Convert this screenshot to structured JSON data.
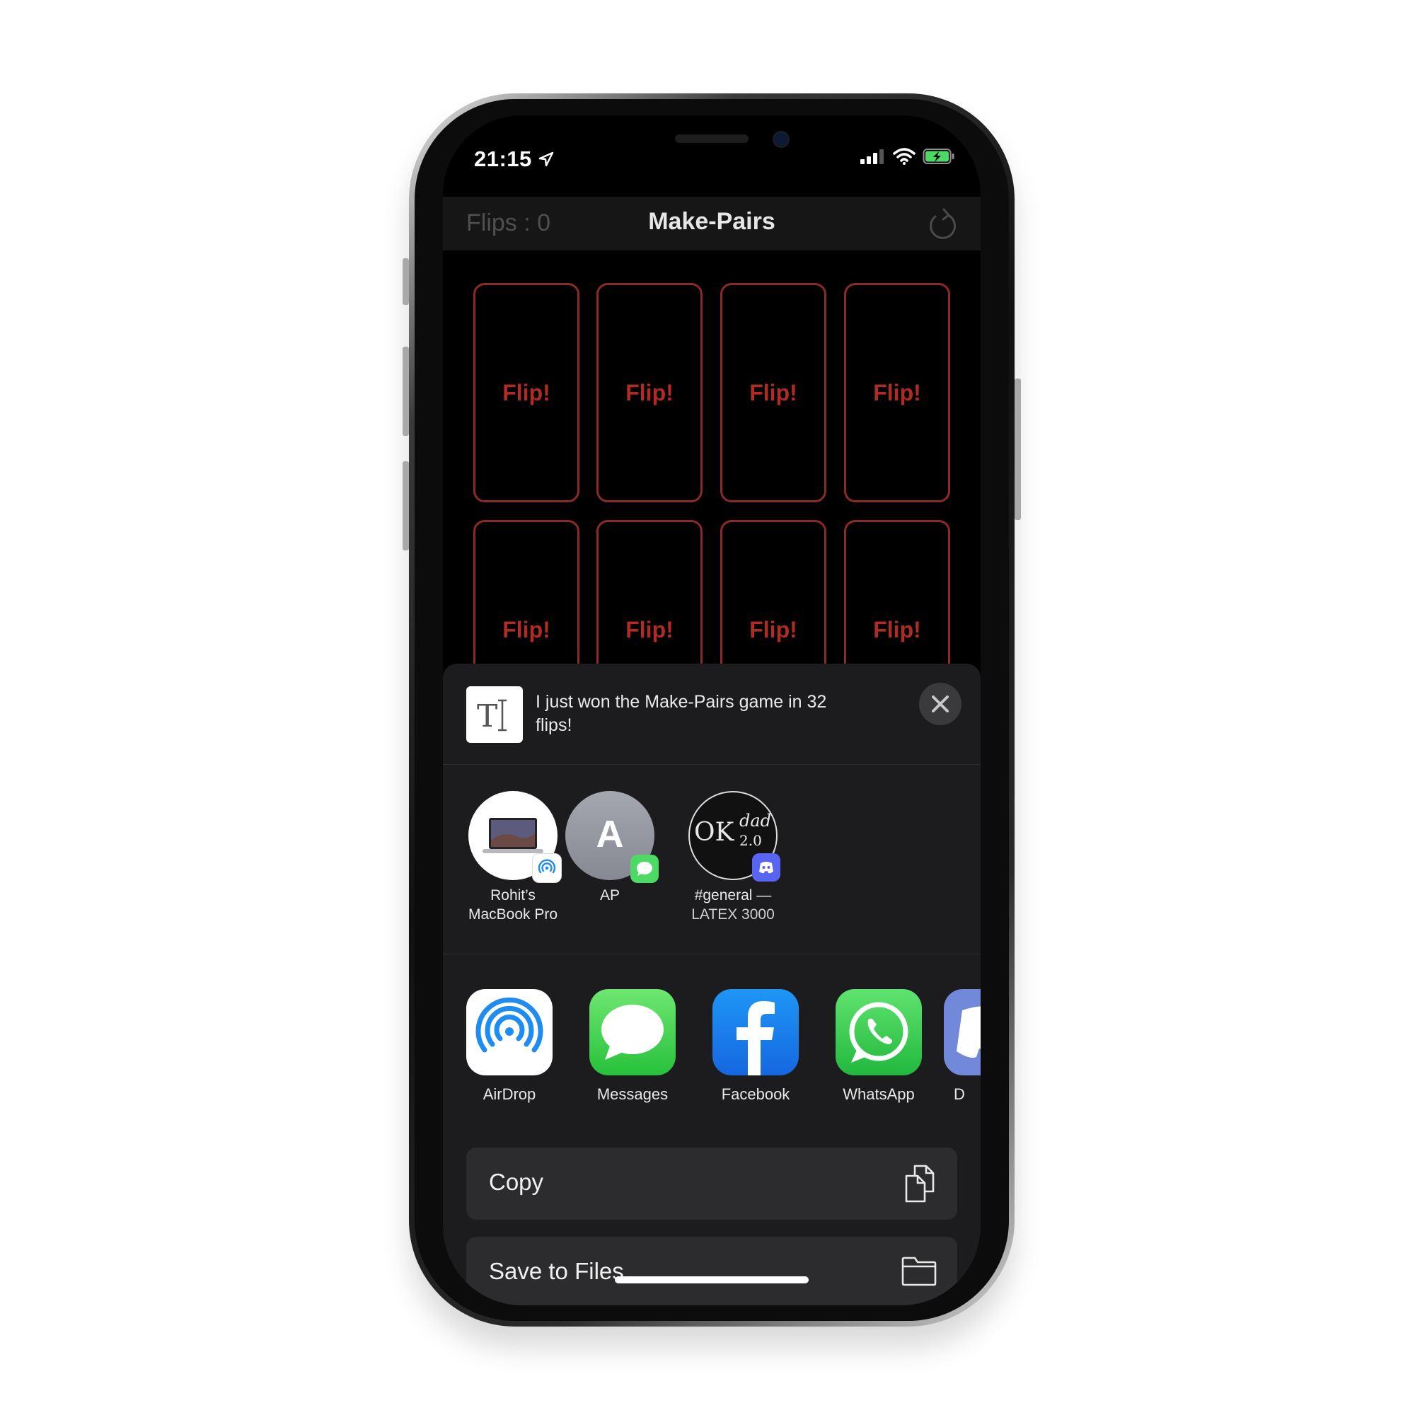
{
  "status": {
    "time": "21:15"
  },
  "navbar": {
    "flips_label": "Flips : 0",
    "title": "Make-Pairs"
  },
  "cards": [
    "Flip!",
    "Flip!",
    "Flip!",
    "Flip!",
    "Flip!",
    "Flip!",
    "Flip!",
    "Flip!"
  ],
  "share": {
    "preview_text": "I just won the Make-Pairs game in 32 flips!",
    "contacts": [
      {
        "line1": "Rohit’s",
        "line2": "MacBook Pro"
      },
      {
        "initial": "A",
        "line1": "AP",
        "line2": ""
      },
      {
        "avatar_text_main": "OK",
        "avatar_text_sup": "dad",
        "avatar_text_sub": "2.0",
        "line1": "#general —",
        "line2": "LATEX 3000"
      }
    ],
    "apps": [
      {
        "label": "AirDrop",
        "icon": "airdrop-icon"
      },
      {
        "label": "Messages",
        "icon": "messages-icon"
      },
      {
        "label": "Facebook",
        "icon": "facebook-icon"
      },
      {
        "label": "WhatsApp",
        "icon": "whatsapp-icon"
      },
      {
        "label": "D",
        "icon": "discord-icon"
      }
    ],
    "actions": [
      {
        "label": "Copy",
        "icon": "copy-icon"
      },
      {
        "label": "Save to Files",
        "icon": "folder-icon"
      }
    ]
  },
  "colors": {
    "card_border": "#8b2a27",
    "card_text": "#b02b24",
    "sheet_bg": "#1c1c1e",
    "action_bg": "#2c2c2e",
    "battery_green": "#4cd964"
  }
}
